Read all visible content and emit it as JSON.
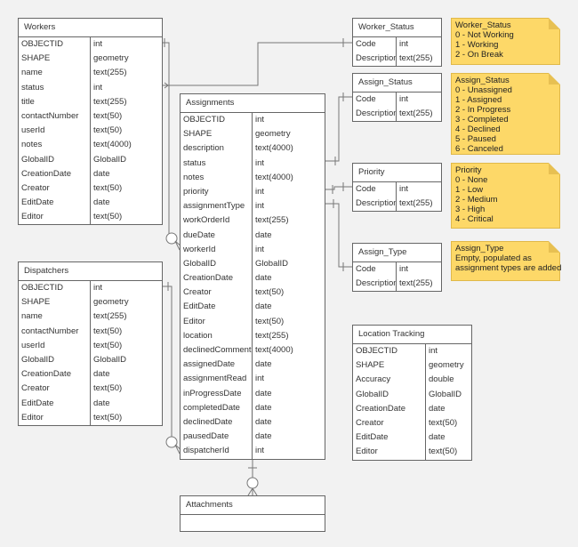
{
  "entities": {
    "workers": {
      "title": "Workers",
      "fields": [
        {
          "name": "OBJECTID",
          "type": "int"
        },
        {
          "name": "SHAPE",
          "type": "geometry"
        },
        {
          "name": "name",
          "type": "text(255)"
        },
        {
          "name": "status",
          "type": "int"
        },
        {
          "name": "title",
          "type": "text(255)"
        },
        {
          "name": "contactNumber",
          "type": "text(50)"
        },
        {
          "name": "userId",
          "type": "text(50)"
        },
        {
          "name": "notes",
          "type": "text(4000)"
        },
        {
          "name": "GlobalID",
          "type": "GlobalID"
        },
        {
          "name": "CreationDate",
          "type": "date"
        },
        {
          "name": "Creator",
          "type": "text(50)"
        },
        {
          "name": "EditDate",
          "type": "date"
        },
        {
          "name": "Editor",
          "type": "text(50)"
        }
      ]
    },
    "dispatchers": {
      "title": "Dispatchers",
      "fields": [
        {
          "name": "OBJECTID",
          "type": "int"
        },
        {
          "name": "SHAPE",
          "type": "geometry"
        },
        {
          "name": "name",
          "type": "text(255)"
        },
        {
          "name": "contactNumber",
          "type": "text(50)"
        },
        {
          "name": "userId",
          "type": "text(50)"
        },
        {
          "name": "GlobalID",
          "type": "GlobalID"
        },
        {
          "name": "CreationDate",
          "type": "date"
        },
        {
          "name": "Creator",
          "type": "text(50)"
        },
        {
          "name": "EditDate",
          "type": "date"
        },
        {
          "name": "Editor",
          "type": "text(50)"
        }
      ]
    },
    "assignments": {
      "title": "Assignments",
      "fields": [
        {
          "name": "OBJECTID",
          "type": "int"
        },
        {
          "name": "SHAPE",
          "type": "geometry"
        },
        {
          "name": "description",
          "type": "text(4000)"
        },
        {
          "name": "status",
          "type": "int"
        },
        {
          "name": "notes",
          "type": "text(4000)"
        },
        {
          "name": "priority",
          "type": "int"
        },
        {
          "name": "assignmentType",
          "type": "int"
        },
        {
          "name": "workOrderId",
          "type": "text(255)"
        },
        {
          "name": "dueDate",
          "type": "date"
        },
        {
          "name": "workerId",
          "type": "int"
        },
        {
          "name": "GlobalID",
          "type": "GlobalID"
        },
        {
          "name": "CreationDate",
          "type": "date"
        },
        {
          "name": "Creator",
          "type": "text(50)"
        },
        {
          "name": "EditDate",
          "type": "date"
        },
        {
          "name": "Editor",
          "type": "text(50)"
        },
        {
          "name": "location",
          "type": "text(255)"
        },
        {
          "name": "declinedComment",
          "type": "text(4000)"
        },
        {
          "name": "assignedDate",
          "type": "date"
        },
        {
          "name": "assignmentRead",
          "type": "int"
        },
        {
          "name": "inProgressDate",
          "type": "date"
        },
        {
          "name": "completedDate",
          "type": "date"
        },
        {
          "name": "declinedDate",
          "type": "date"
        },
        {
          "name": "pausedDate",
          "type": "date"
        },
        {
          "name": "dispatcherId",
          "type": "int"
        }
      ]
    },
    "attachments": {
      "title": "Attachments",
      "fields": []
    },
    "worker_status": {
      "title": "Worker_Status",
      "fields": [
        {
          "name": "Code",
          "type": "int"
        },
        {
          "name": "Description",
          "type": "text(255)"
        }
      ]
    },
    "assign_status": {
      "title": "Assign_Status",
      "fields": [
        {
          "name": "Code",
          "type": "int"
        },
        {
          "name": "Description",
          "type": "text(255)"
        }
      ]
    },
    "priority": {
      "title": "Priority",
      "fields": [
        {
          "name": "Code",
          "type": "int"
        },
        {
          "name": "Description",
          "type": "text(255)"
        }
      ]
    },
    "assign_type": {
      "title": "Assign_Type",
      "fields": [
        {
          "name": "Code",
          "type": "int"
        },
        {
          "name": "Description",
          "type": "text(255)"
        }
      ]
    },
    "location_tracking": {
      "title": "Location Tracking",
      "fields": [
        {
          "name": "OBJECTID",
          "type": "int"
        },
        {
          "name": "SHAPE",
          "type": "geometry"
        },
        {
          "name": "Accuracy",
          "type": "double"
        },
        {
          "name": "GlobalID",
          "type": "GlobalID"
        },
        {
          "name": "CreationDate",
          "type": "date"
        },
        {
          "name": "Creator",
          "type": "text(50)"
        },
        {
          "name": "EditDate",
          "type": "date"
        },
        {
          "name": "Editor",
          "type": "text(50)"
        }
      ]
    }
  },
  "notes": {
    "worker_status": [
      "Worker_Status",
      "0 - Not Working",
      "1 - Working",
      "2 - On Break"
    ],
    "assign_status": [
      "Assign_Status",
      "0 - Unassigned",
      "1 - Assigned",
      "2 - In Progress",
      "3 - Completed",
      "4 - Declined",
      "5 - Paused",
      "6 - Canceled"
    ],
    "priority": [
      "Priority",
      "0 - None",
      "1 - Low",
      "2 - Medium",
      "3 - High",
      "4 - Critical"
    ],
    "assign_type": [
      "Assign_Type",
      "Empty, populated as",
      "assignment types are added"
    ]
  },
  "colors": {
    "background": "#f2f2f2",
    "note_fill": "#fdd868",
    "line": "#777777"
  }
}
